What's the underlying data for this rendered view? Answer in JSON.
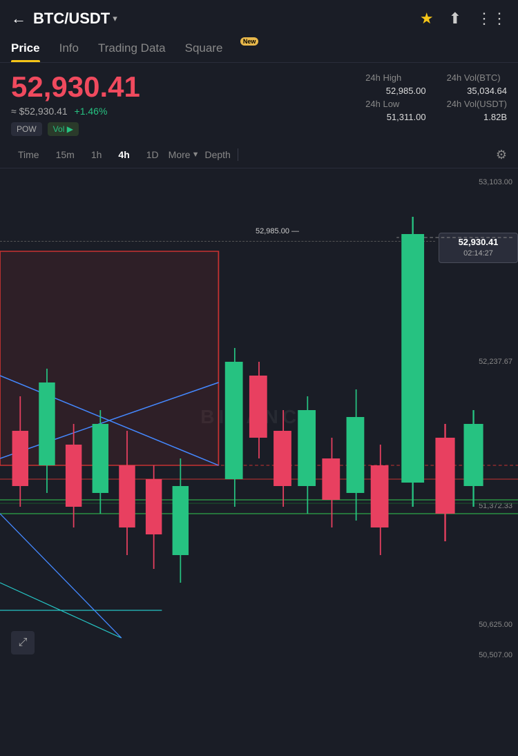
{
  "header": {
    "back_label": "←",
    "pair": "BTC/USDT",
    "dropdown": "▾",
    "icons": {
      "star": "★",
      "share": "⬆",
      "grid": "⊞"
    }
  },
  "tabs": [
    {
      "id": "price",
      "label": "Price",
      "active": true,
      "badge": null
    },
    {
      "id": "info",
      "label": "Info",
      "active": false,
      "badge": null
    },
    {
      "id": "trading-data",
      "label": "Trading Data",
      "active": false,
      "badge": null
    },
    {
      "id": "square",
      "label": "Square",
      "active": false,
      "badge": "New"
    }
  ],
  "price": {
    "main": "52,930.41",
    "usd": "≈ $52,930.41",
    "change": "+1.46%",
    "tags": [
      "POW",
      "Vol ▶"
    ]
  },
  "stats": {
    "high_label": "24h High",
    "high_value": "52,985.00",
    "vol_btc_label": "24h Vol(BTC)",
    "vol_btc_value": "35,034.64",
    "low_label": "24h Low",
    "low_value": "51,311.00",
    "vol_usdt_label": "24h Vol(USDT)",
    "vol_usdt_value": "1.82B"
  },
  "chart_controls": {
    "time_label": "Time",
    "intervals": [
      "15m",
      "1h",
      "4h",
      "1D"
    ],
    "active_interval": "4h",
    "more_label": "More",
    "depth_label": "Depth"
  },
  "chart": {
    "watermark": "BINANCE",
    "price_labels": [
      {
        "value": "53,103.00",
        "y_pct": 2
      },
      {
        "value": "52,985.00",
        "y_pct": 13
      },
      {
        "value": "52,237.67",
        "y_pct": 38
      },
      {
        "value": "51,372.33",
        "y_pct": 67
      },
      {
        "value": "50,625.00",
        "y_pct": 91
      },
      {
        "value": "50,507.00",
        "y_pct": 97
      }
    ],
    "current_price": "52,930.41",
    "current_time": "02:14:27"
  },
  "fullscreen": "⤢"
}
